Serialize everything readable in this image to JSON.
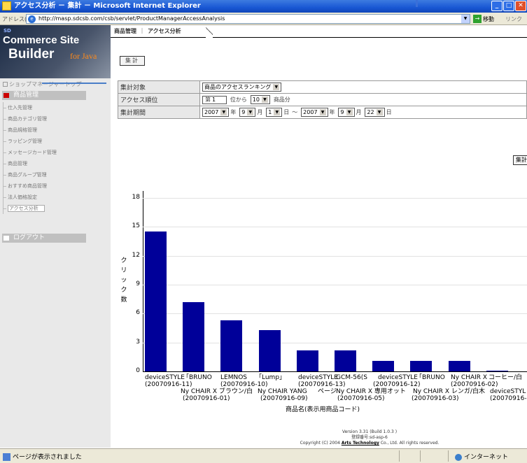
{
  "window": {
    "title": "アクセス分析 － 集計 － Microsoft Internet Explorer",
    "min": "_",
    "max": "□",
    "close": "✕"
  },
  "address": {
    "label": "アドレス(D)",
    "url": "http://masp.sdcsb.com/csb/servlet/ProductManagerAccessAnalysis",
    "go": "移動",
    "links": "リンク"
  },
  "logo": {
    "sd": "SD",
    "line1": "Commerce Site",
    "line2": "Builder",
    "line3": "for Java"
  },
  "sidebar": {
    "top": "ショップマネージャートップ",
    "category": "商品管理",
    "items": [
      "仕入先管理",
      "商品カテゴリ管理",
      "商品規格管理",
      "ラッピング管理",
      "メッセージカード管理",
      "商品管理",
      "商品グループ管理",
      "おすすめ商品管理",
      "法人価格設定",
      "アクセス分析"
    ],
    "logout": "ログアウト"
  },
  "breadcrumb": {
    "section": "商品管理",
    "sep": "｜",
    "page": "アクセス分析"
  },
  "buttons": {
    "tally_top": "集計",
    "tally_right": "集計"
  },
  "form": {
    "target_label": "集計対象",
    "target_value": "商品のアクセスランキング",
    "rank_label": "アクセス順位",
    "rank_prefix": "第",
    "rank_start": "1",
    "rank_mid": "位から",
    "rank_count": "10",
    "rank_suffix": "商品分",
    "period_label": "集計期間",
    "from_year": "2007",
    "from_month": "9",
    "from_day": "1",
    "to_year": "2007",
    "to_month": "9",
    "to_day": "22",
    "year_unit": "年",
    "month_unit": "月",
    "day_unit": "日",
    "range_sep": "～"
  },
  "chart_data": {
    "type": "bar",
    "ylabel": "クリック数",
    "xlabel": "商品名(表示用商品コード)",
    "ylim": [
      0,
      18
    ],
    "yticks": [
      "0",
      "3",
      "6",
      "9",
      "12",
      "15",
      "18"
    ],
    "categories": [
      "deviceSTYLE (20070916-11)",
      "Ny CHAIR X ブラウン/白 (20070916-01)",
      "「BRUNO (20070916-10)",
      "LEMNOS Ny CHAIR YANG (20070916-09)",
      "「Lump」ページ",
      "deviceSTYLE (20070916-13)",
      "Ny CHAIR X 専用オット (20070916-05)",
      "GCM-56(SdeviceSTYLE (20070916-12)",
      "Ny CHAIR X レンガ/白木 (20070916-03)",
      "「BRUNO (20070916-02)"
    ],
    "values": [
      14.5,
      7.2,
      5.3,
      4.3,
      2.2,
      2.2,
      1.1,
      1.1,
      1.1,
      0.1
    ],
    "top_labels": [
      "deviceSTYLE",
      "「BRUNO",
      "LEMNOS",
      "「Lump」",
      "deviceSTYLE",
      "GCM-56(S",
      "deviceSTYLE",
      "「BRUNO",
      "Ny CHAIR X",
      "コーヒー/白"
    ],
    "codes_row1": [
      "(20070916-11)",
      "(20070916-10)",
      "(20070916-13)",
      "(20070916-12)",
      "(20070916-02)"
    ],
    "names_row2": [
      "Ny CHAIR X ブラウン/白",
      "Ny CHAIR YANG",
      "ページ",
      "Ny CHAIR X 専用オット",
      "Ny CHAIR X レンガ/白木",
      "deviceSTYL"
    ],
    "codes_row3": [
      "(20070916-01)",
      "(20070916-09)",
      "(20070916-05)",
      "(20070916-03)",
      "(20070916-"
    ],
    "color": "#000099"
  },
  "footer": {
    "version": "Version 3.31 (Build 1.0.3 )",
    "reg": "登録番号:sd-asp-6",
    "copy_pre": "Copyright (C) 2004 ",
    "company": "Arts Technology",
    "copy_post": " Co., Ltd. All rights reserved."
  },
  "status": {
    "text": "ページが表示されました",
    "zone": "インターネット"
  }
}
